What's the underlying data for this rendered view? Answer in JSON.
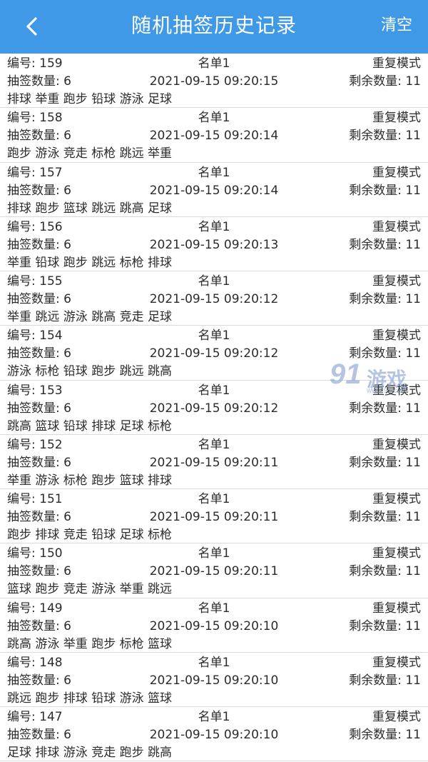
{
  "header": {
    "back_icon": "chevron-left-icon",
    "title": "随机抽签历史记录",
    "clear_label": "清空"
  },
  "labels": {
    "id_prefix": "编号:",
    "count_prefix": "抽签数量:",
    "remaining_prefix": "剩余数量:"
  },
  "records": [
    {
      "id": "159",
      "list": "名单1",
      "mode": "重复模式",
      "count": "6",
      "time": "2021-09-15 09:20:15",
      "remaining": "11",
      "result": "排球 举重 跑步 铅球 游泳 足球"
    },
    {
      "id": "158",
      "list": "名单1",
      "mode": "重复模式",
      "count": "6",
      "time": "2021-09-15 09:20:14",
      "remaining": "11",
      "result": "跑步 游泳 竞走 标枪 跳远 举重"
    },
    {
      "id": "157",
      "list": "名单1",
      "mode": "重复模式",
      "count": "6",
      "time": "2021-09-15 09:20:14",
      "remaining": "11",
      "result": "排球 跑步 篮球 跳远 跳高 足球"
    },
    {
      "id": "156",
      "list": "名单1",
      "mode": "重复模式",
      "count": "6",
      "time": "2021-09-15 09:20:13",
      "remaining": "11",
      "result": "举重 铅球 跑步 跳远 标枪 排球"
    },
    {
      "id": "155",
      "list": "名单1",
      "mode": "重复模式",
      "count": "6",
      "time": "2021-09-15 09:20:12",
      "remaining": "11",
      "result": "举重 跳远 游泳 跳高 竞走 足球"
    },
    {
      "id": "154",
      "list": "名单1",
      "mode": "重复模式",
      "count": "6",
      "time": "2021-09-15 09:20:12",
      "remaining": "11",
      "result": "游泳 标枪 铅球 跑步 跳远 跳高"
    },
    {
      "id": "153",
      "list": "名单1",
      "mode": "重复模式",
      "count": "6",
      "time": "2021-09-15 09:20:12",
      "remaining": "11",
      "result": "跳高 篮球 铅球 排球 足球 标枪"
    },
    {
      "id": "152",
      "list": "名单1",
      "mode": "重复模式",
      "count": "6",
      "time": "2021-09-15 09:20:11",
      "remaining": "11",
      "result": "举重 游泳 标枪 跑步 篮球 排球"
    },
    {
      "id": "151",
      "list": "名单1",
      "mode": "重复模式",
      "count": "6",
      "time": "2021-09-15 09:20:11",
      "remaining": "11",
      "result": "跑步 排球 竞走 铅球 足球 标枪"
    },
    {
      "id": "150",
      "list": "名单1",
      "mode": "重复模式",
      "count": "6",
      "time": "2021-09-15 09:20:11",
      "remaining": "11",
      "result": "篮球 跑步 竞走 游泳 举重 跳远"
    },
    {
      "id": "149",
      "list": "名单1",
      "mode": "重复模式",
      "count": "6",
      "time": "2021-09-15 09:20:10",
      "remaining": "11",
      "result": "跳高 游泳 举重 跑步 标枪 篮球"
    },
    {
      "id": "148",
      "list": "名单1",
      "mode": "重复模式",
      "count": "6",
      "time": "2021-09-15 09:20:10",
      "remaining": "11",
      "result": "跳远 跑步 排球 铅球 游泳 篮球"
    },
    {
      "id": "147",
      "list": "名单1",
      "mode": "重复模式",
      "count": "6",
      "time": "2021-09-15 09:20:10",
      "remaining": "11",
      "result": "足球 排球 游泳 竞走 跑步 跳高"
    }
  ],
  "watermark": {
    "number": "91",
    "text": "游戏",
    "url": "www.91.com"
  }
}
